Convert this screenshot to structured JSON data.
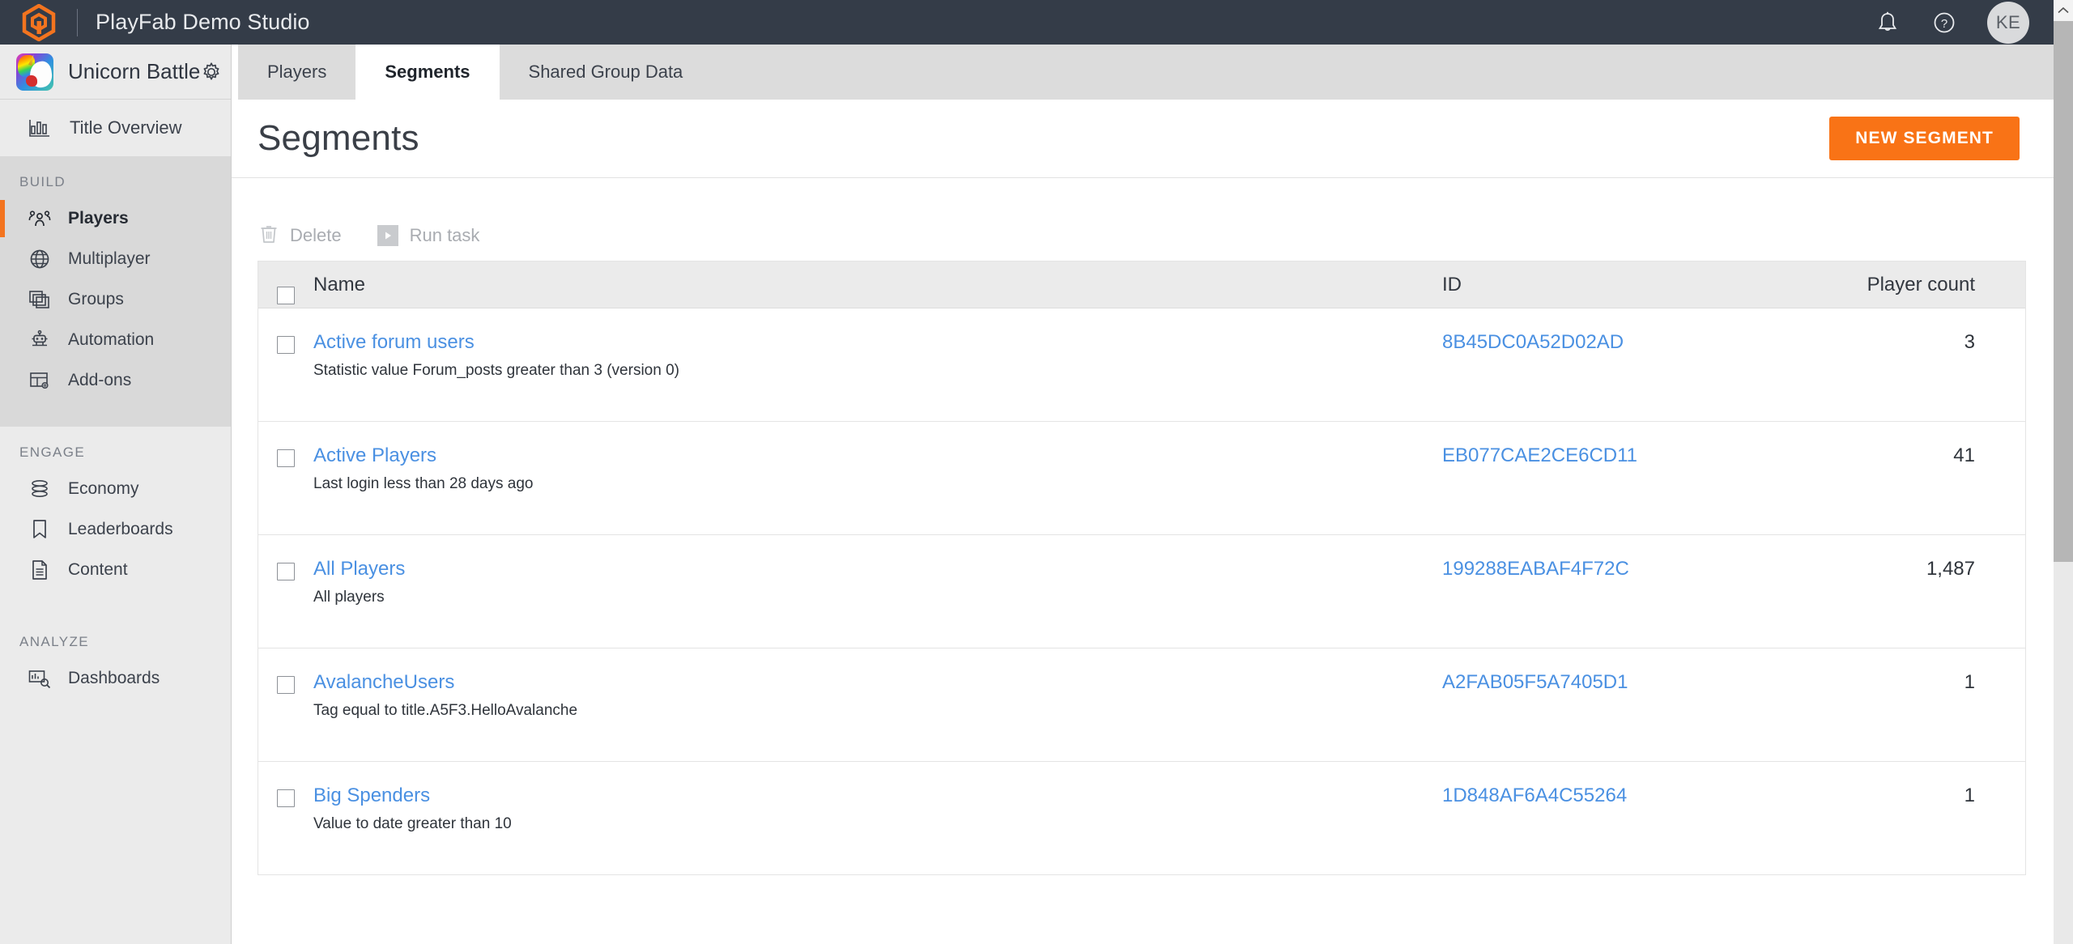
{
  "topbar": {
    "logo_icon": "playfab-hexagon-logo",
    "studio_title": "PlayFab Demo Studio",
    "notifications_icon": "bell-icon",
    "help_icon": "help-circle-icon",
    "avatar_initials": "KE",
    "accent_color": "#f3741f",
    "background_color": "#343c48"
  },
  "sidebar": {
    "title_name": "Unicorn Battle",
    "title_icon": "unicorn-avatar",
    "settings_icon": "gear-icon",
    "overview": {
      "label": "Title Overview",
      "icon": "bar-chart-icon"
    },
    "groups": [
      {
        "label": "BUILD",
        "items": [
          {
            "label": "Players",
            "icon": "people-icon",
            "active": true
          },
          {
            "label": "Multiplayer",
            "icon": "globe-icon",
            "active": false
          },
          {
            "label": "Groups",
            "icon": "stacked-squares-icon",
            "active": false
          },
          {
            "label": "Automation",
            "icon": "robot-icon",
            "active": false
          },
          {
            "label": "Add-ons",
            "icon": "table-gear-icon",
            "active": false
          }
        ]
      },
      {
        "label": "ENGAGE",
        "items": [
          {
            "label": "Economy",
            "icon": "coin-stack-icon",
            "active": false
          },
          {
            "label": "Leaderboards",
            "icon": "bookmark-icon",
            "active": false
          },
          {
            "label": "Content",
            "icon": "document-icon",
            "active": false
          }
        ]
      },
      {
        "label": "ANALYZE",
        "items": [
          {
            "label": "Dashboards",
            "icon": "chart-search-icon",
            "active": false
          }
        ]
      }
    ]
  },
  "tabs": [
    {
      "label": "Players",
      "active": false
    },
    {
      "label": "Segments",
      "active": true
    },
    {
      "label": "Shared Group Data",
      "active": false
    }
  ],
  "page": {
    "title": "Segments",
    "new_button": "NEW SEGMENT",
    "new_button_color": "#f97316"
  },
  "toolbar": {
    "delete_label": "Delete",
    "delete_icon": "trash-icon",
    "run_task_label": "Run task",
    "run_task_icon": "play-icon"
  },
  "table": {
    "columns": {
      "name": "Name",
      "id": "ID",
      "count": "Player count"
    },
    "select_all_icon": "checkbox-unchecked",
    "rows": [
      {
        "name": "Active forum users",
        "description": "Statistic value Forum_posts greater than 3 (version 0)",
        "id": "8B45DC0A52D02AD",
        "player_count": "3"
      },
      {
        "name": "Active Players",
        "description": "Last login less than 28 days ago",
        "id": "EB077CAE2CE6CD11",
        "player_count": "41"
      },
      {
        "name": "All Players",
        "description": "All players",
        "id": "199288EABAF4F72C",
        "player_count": "1,487"
      },
      {
        "name": "AvalancheUsers",
        "description": "Tag equal to title.A5F3.HelloAvalanche",
        "id": "A2FAB05F5A7405D1",
        "player_count": "1"
      },
      {
        "name": "Big Spenders",
        "description": "Value to date greater than 10",
        "id": "1D848AF6A4C55264",
        "player_count": "1"
      }
    ]
  },
  "scrollbar": {
    "up_arrow_icon": "chevron-up-icon"
  }
}
